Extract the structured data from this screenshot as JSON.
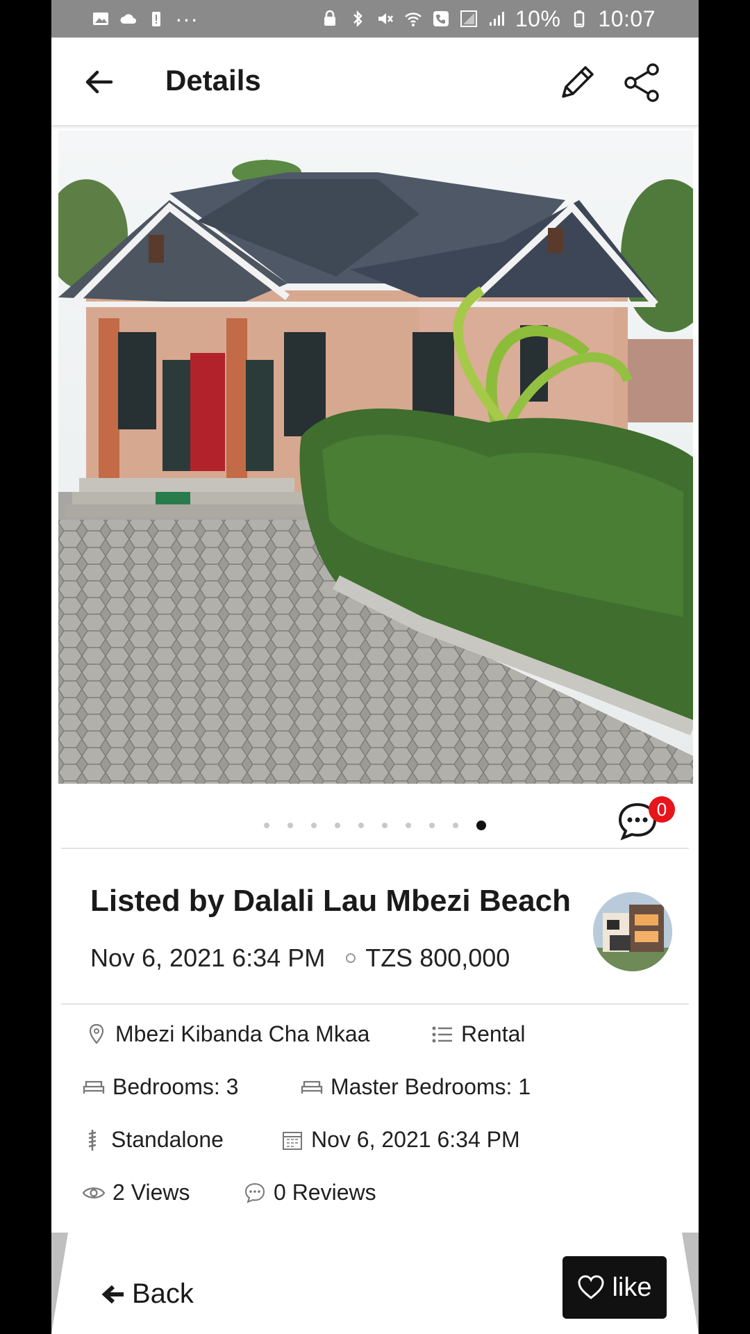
{
  "status_bar": {
    "battery": "10%",
    "time": "10:07",
    "more": "···"
  },
  "app_bar": {
    "title": "Details"
  },
  "gallery": {
    "dot_count": 10,
    "active_index": 9,
    "comment_count": "0"
  },
  "listing": {
    "listed_by": "Listed by Dalali Lau Mbezi Beach",
    "posted": "Nov 6, 2021 6:34 PM",
    "price": "TZS 800,000"
  },
  "details": {
    "location": "Mbezi Kibanda Cha Mkaa",
    "category": "Rental",
    "bedrooms": "Bedrooms: 3",
    "master_bedrooms": "Master Bedrooms: 1",
    "type": "Standalone",
    "date": "Nov 6, 2021 6:34 PM",
    "views": "2 Views",
    "reviews": "0 Reviews"
  },
  "bottom": {
    "back_label": "Back",
    "like_label": "like"
  },
  "colors": {
    "status_bar_bg": "#8a8a8a",
    "badge": "#e8141b",
    "like_bg": "#111111"
  }
}
